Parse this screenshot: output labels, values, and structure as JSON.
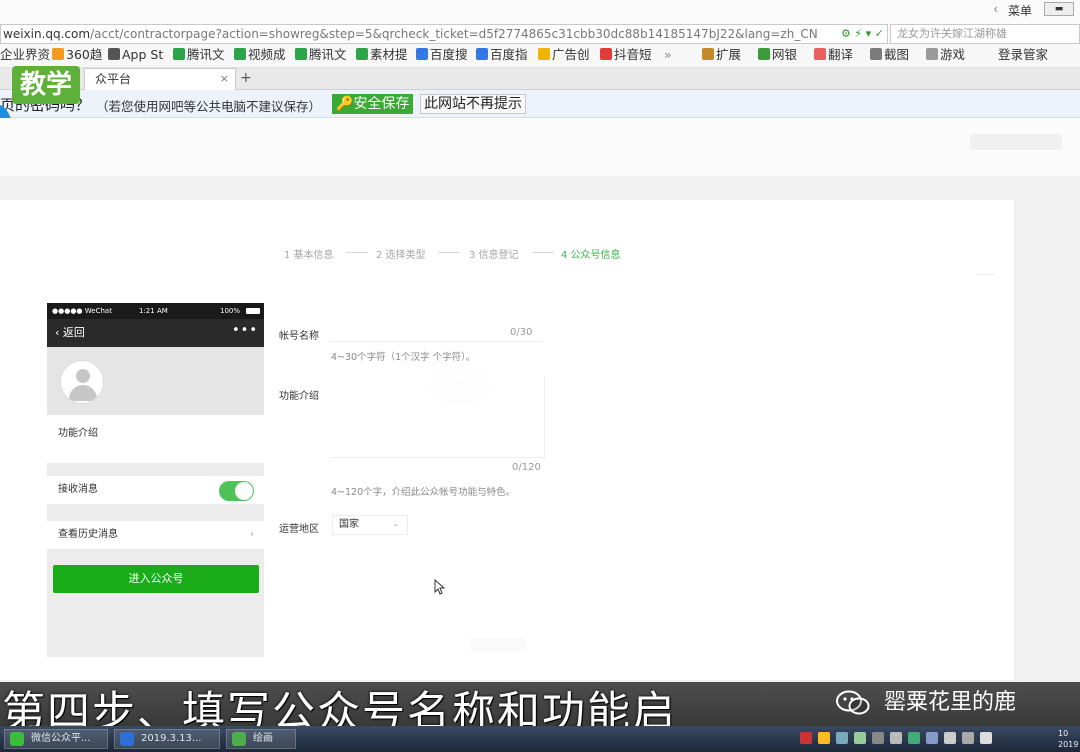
{
  "browser": {
    "url_host": "weixin.qq.com",
    "url_rest": "/acct/contractorpage?action=showreg&step=5&qrcheck_ticket=d5f2774865c31cbb30dc88b14185147bJ22&lang=zh_CN",
    "search_text": "龙女为许关嫁江湖称雄",
    "menu_label": "菜单",
    "back_glyph": "‹",
    "bookmarks": [
      "企业界资",
      "360趋",
      "App St",
      "腾讯文",
      "视频成",
      "腾讯文",
      "素材提",
      "百度搜",
      "百度指",
      "广告创",
      "抖音短",
      "扩展",
      "网银",
      "翻译",
      "截图",
      "游戏",
      "登录管家"
    ],
    "more_glyph": "»",
    "tab_title": "众平台",
    "tab_close": "×",
    "new_tab": "+"
  },
  "save_prompt": {
    "question": "页的密码吗？",
    "hint": "（若您使用网吧等公共电脑不建议保存）",
    "save_label": "安全保存",
    "never_label": "此网站不再提示"
  },
  "logo_text": "教学",
  "steps": [
    {
      "label": "1 基本信息",
      "active": false
    },
    {
      "label": "2 选择类型",
      "active": false
    },
    {
      "label": "3 信息登记",
      "active": false
    },
    {
      "label": "4 公众号信息",
      "active": true
    }
  ],
  "phone": {
    "carrier": "●●●●● WeChat",
    "time": "1:21 AM",
    "battery": "100%",
    "back_label": "返回",
    "more": "•••",
    "intro_label": "功能介绍",
    "receive_label": "接收消息",
    "receive_on": true,
    "history_label": "查看历史消息",
    "enter_button": "进入公众号"
  },
  "form": {
    "name_label": "帐号名称",
    "name_count": "0/30",
    "name_hint": "4~30个字符（1个汉字        个字符）。",
    "intro_label": "功能介绍",
    "intro_count": "0/120",
    "intro_hint": "4~120个字，介绍此公众帐号功能与特色。",
    "region_label": "运营地区",
    "region_value": "国家"
  },
  "caption": "第四步、填写公众号名称和功能启",
  "watermark": "罂粟花里的鹿",
  "taskbar": {
    "items": [
      "微信公众平...",
      "2019.3.13...",
      "绘画"
    ],
    "clock": [
      "10",
      "2019"
    ]
  },
  "colors": {
    "accent_green": "#3db34a",
    "button_green": "#1aad19",
    "save_green": "#3aa935",
    "logo_green": "#5db039"
  }
}
